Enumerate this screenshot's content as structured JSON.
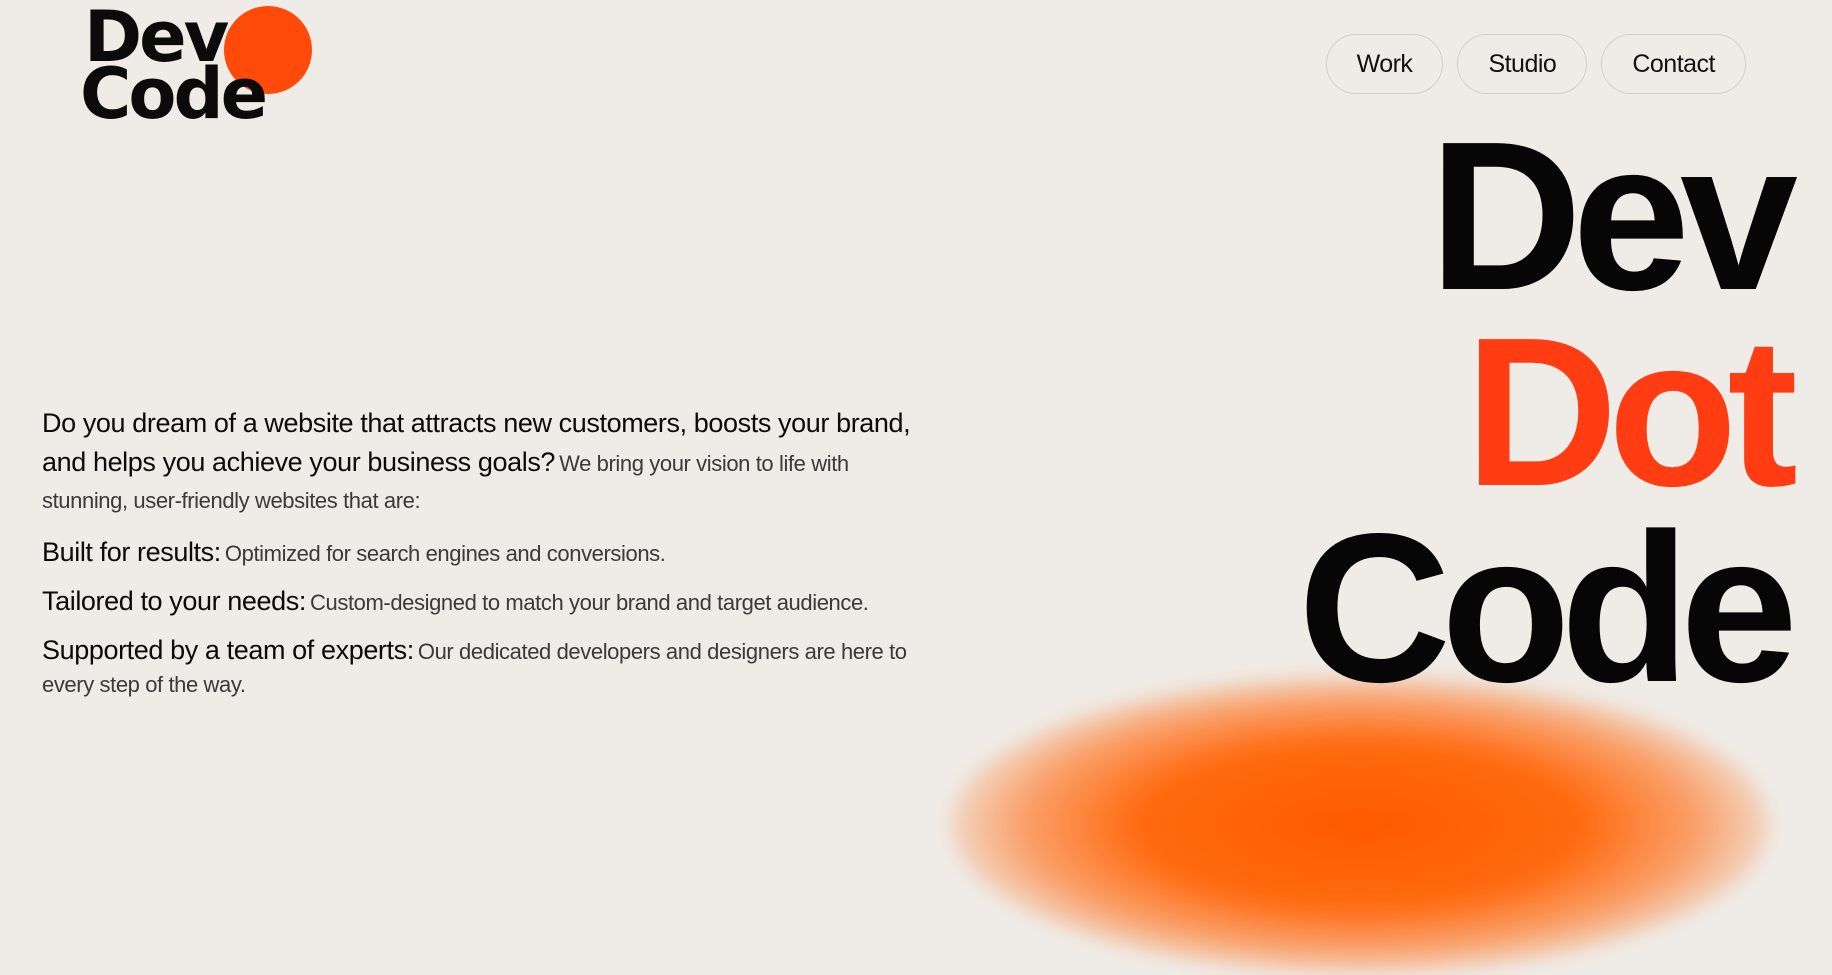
{
  "logo": {
    "line1": "Dev",
    "line2": "Code",
    "accent_color": "#ff4a0a"
  },
  "nav": {
    "items": [
      {
        "label": "Work"
      },
      {
        "label": "Studio"
      },
      {
        "label": "Contact"
      }
    ]
  },
  "hero": {
    "word1": "Dev",
    "word2": "Dot",
    "word3": "Code",
    "accent_color": "#ff3c12"
  },
  "copy": {
    "intro_lead": "Do you dream of a website that attracts new customers, boosts your brand, and helps you achieve your business goals?",
    "intro_body": "We bring your vision to life with stunning, user-friendly websites that are:",
    "points": [
      {
        "lead": "Built for results:",
        "body": "Optimized for search engines and conversions."
      },
      {
        "lead": "Tailored to your needs:",
        "body": "Custom-designed to match your brand and target audience."
      },
      {
        "lead": "Supported by a team of experts:",
        "body": "Our dedicated developers and designers are here to every step of the way."
      }
    ]
  },
  "colors": {
    "background": "#efebe6",
    "text": "#0b0b0b",
    "glow": "#ff5a00"
  }
}
